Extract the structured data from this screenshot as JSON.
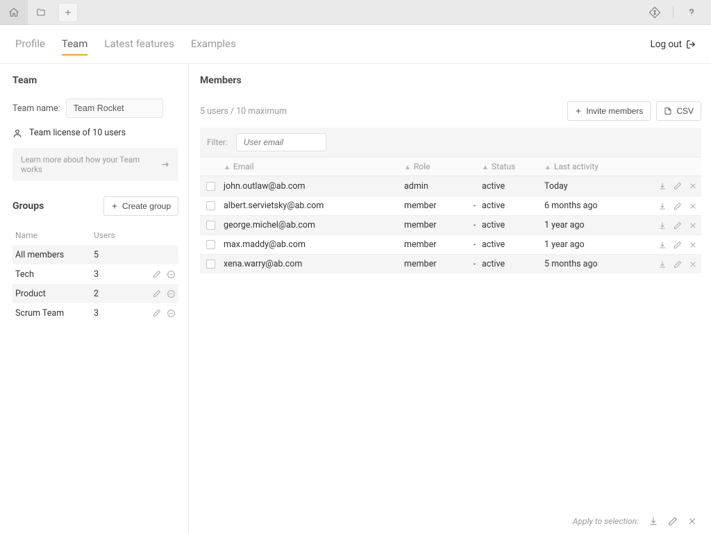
{
  "nav": {
    "tabs": [
      "Profile",
      "Team",
      "Latest features",
      "Examples"
    ],
    "active": "Team",
    "logout": "Log out"
  },
  "sidebar": {
    "title": "Team",
    "team_name_label": "Team name:",
    "team_name_value": "Team Rocket",
    "license_text": "Team license of 10 users",
    "learn_more": "Learn more about how your Team works"
  },
  "groups": {
    "title": "Groups",
    "create_label": "Create group",
    "headers": {
      "name": "Name",
      "users": "Users"
    },
    "rows": [
      {
        "name": "All members",
        "users": "5",
        "show_actions": false
      },
      {
        "name": "Tech",
        "users": "3",
        "show_actions": true
      },
      {
        "name": "Product",
        "users": "2",
        "show_actions": true
      },
      {
        "name": "Scrum Team",
        "users": "3",
        "show_actions": true
      }
    ]
  },
  "members": {
    "title": "Members",
    "counter": "5 users / 10 maximum",
    "invite_label": "Invite members",
    "csv_label": "CSV",
    "filter_label": "Filter:",
    "filter_placeholder": "User email",
    "columns": {
      "email": "Email",
      "role": "Role",
      "status": "Status",
      "activity": "Last activity"
    },
    "rows": [
      {
        "email": "john.outlaw@ab.com",
        "role": "admin",
        "caret": false,
        "status": "active",
        "activity": "Today"
      },
      {
        "email": "albert.servietsky@ab.com",
        "role": "member",
        "caret": true,
        "status": "active",
        "activity": "6 months ago"
      },
      {
        "email": "george.michel@ab.com",
        "role": "member",
        "caret": true,
        "status": "active",
        "activity": "1 year ago"
      },
      {
        "email": "max.maddy@ab.com",
        "role": "member",
        "caret": true,
        "status": "active",
        "activity": "1 year ago"
      },
      {
        "email": "xena.warry@ab.com",
        "role": "member",
        "caret": true,
        "status": "active",
        "activity": "5 months ago"
      }
    ],
    "footer_label": "Apply to selection:"
  }
}
